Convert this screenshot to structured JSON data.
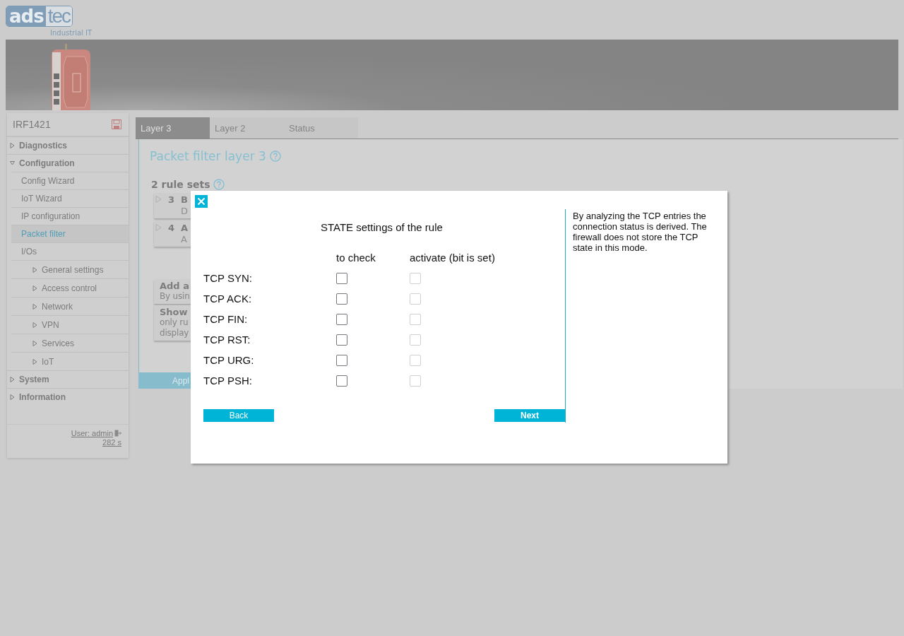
{
  "header": {
    "logo": {
      "left": "ads",
      "right": "tec"
    },
    "tagline": "Industrial IT"
  },
  "sidebar": {
    "device": "IRF1421",
    "items": [
      {
        "label": "Diagnostics",
        "expanded": false,
        "selected": false
      },
      {
        "label": "Configuration",
        "expanded": true,
        "selected": false,
        "children": [
          {
            "label": "Config Wizard",
            "selected": false
          },
          {
            "label": "IoT Wizard",
            "selected": false
          },
          {
            "label": "IP configuration",
            "selected": false
          },
          {
            "label": "Packet filter",
            "selected": true
          },
          {
            "label": "I/Os",
            "selected": false,
            "children": [
              {
                "label": "General settings",
                "expanded": false,
                "selected": false
              },
              {
                "label": "Access control",
                "expanded": false,
                "selected": false
              },
              {
                "label": "Network",
                "expanded": false,
                "selected": false
              },
              {
                "label": "VPN",
                "expanded": false,
                "selected": false
              },
              {
                "label": "Services",
                "expanded": false,
                "selected": false
              },
              {
                "label": "IoT",
                "expanded": false,
                "selected": false
              }
            ]
          }
        ]
      },
      {
        "label": "System",
        "expanded": false,
        "selected": false
      },
      {
        "label": "Information",
        "expanded": false,
        "selected": false
      }
    ],
    "user": "User: admin",
    "timer": "282 s"
  },
  "tabs": [
    {
      "label": "Layer 3",
      "selected": true
    },
    {
      "label": "Layer 2",
      "selected": false
    },
    {
      "label": "Status",
      "selected": false
    }
  ],
  "content": {
    "title": "Packet filter layer 3",
    "rule_sets_heading": "2 rule sets",
    "rules": [
      {
        "number": "3",
        "name": "B",
        "description": "D"
      },
      {
        "number": "4",
        "name": "A",
        "description": "A"
      }
    ],
    "info_cards": [
      {
        "title": "Add a",
        "lines": [
          "By usin"
        ]
      },
      {
        "title": "Show",
        "lines": [
          "only ru",
          "display"
        ]
      }
    ],
    "apply_button": "Appl"
  },
  "dialog": {
    "heading": "STATE settings of the rule",
    "columns": [
      "to check",
      "activate (bit is set)"
    ],
    "rows": [
      {
        "label": "TCP SYN:",
        "to_check": {
          "checked": false
        },
        "activate": {
          "checked": false,
          "disabled": true
        }
      },
      {
        "label": "TCP ACK:",
        "to_check": {
          "checked": false
        },
        "activate": {
          "checked": false,
          "disabled": true
        }
      },
      {
        "label": "TCP FIN:",
        "to_check": {
          "checked": false
        },
        "activate": {
          "checked": false,
          "disabled": true
        }
      },
      {
        "label": "TCP RST:",
        "to_check": {
          "checked": false
        },
        "activate": {
          "checked": false,
          "disabled": true
        }
      },
      {
        "label": "TCP URG:",
        "to_check": {
          "checked": false
        },
        "activate": {
          "checked": false,
          "disabled": true
        }
      },
      {
        "label": "TCP PSH:",
        "to_check": {
          "checked": false
        },
        "activate": {
          "checked": false,
          "disabled": true
        }
      }
    ],
    "back_button": "Back",
    "next_button": "Next",
    "help": "By analyzing the TCP entries the connection status is derived. The firewall does not store the TCP state in this mode."
  }
}
